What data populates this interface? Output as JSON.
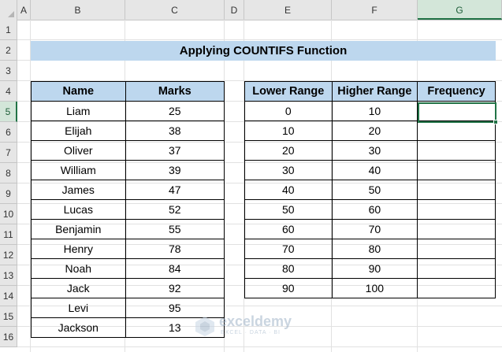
{
  "sheet": {
    "columns": [
      "A",
      "B",
      "C",
      "D",
      "E",
      "F",
      "G"
    ],
    "selected_column": "G",
    "rows": [
      "1",
      "2",
      "3",
      "4",
      "5",
      "6",
      "7",
      "8",
      "9",
      "10",
      "11",
      "12",
      "13",
      "14",
      "15",
      "16"
    ],
    "selected_row": "5",
    "title": "Applying COUNTIFS Function"
  },
  "marks_table": {
    "headers": [
      "Name",
      "Marks"
    ],
    "rows": [
      [
        "Liam",
        "25"
      ],
      [
        "Elijah",
        "38"
      ],
      [
        "Oliver",
        "37"
      ],
      [
        "William",
        "39"
      ],
      [
        "James",
        "47"
      ],
      [
        "Lucas",
        "52"
      ],
      [
        "Benjamin",
        "55"
      ],
      [
        "Henry",
        "78"
      ],
      [
        "Noah",
        "84"
      ],
      [
        "Jack",
        "92"
      ],
      [
        "Levi",
        "95"
      ],
      [
        "Jackson",
        "13"
      ]
    ]
  },
  "range_table": {
    "headers": [
      "Lower Range",
      "Higher Range",
      "Frequency"
    ],
    "rows": [
      [
        "0",
        "10",
        ""
      ],
      [
        "10",
        "20",
        ""
      ],
      [
        "20",
        "30",
        ""
      ],
      [
        "30",
        "40",
        ""
      ],
      [
        "40",
        "50",
        ""
      ],
      [
        "50",
        "60",
        ""
      ],
      [
        "60",
        "70",
        ""
      ],
      [
        "70",
        "80",
        ""
      ],
      [
        "80",
        "90",
        ""
      ],
      [
        "90",
        "100",
        ""
      ]
    ]
  },
  "watermark": {
    "name": "exceldemy",
    "tagline": "EXCEL · DATA · BI",
    "icon": "exceldemy-logo-icon"
  },
  "colors": {
    "header_fill": "#bdd7ee",
    "selection": "#217346"
  }
}
